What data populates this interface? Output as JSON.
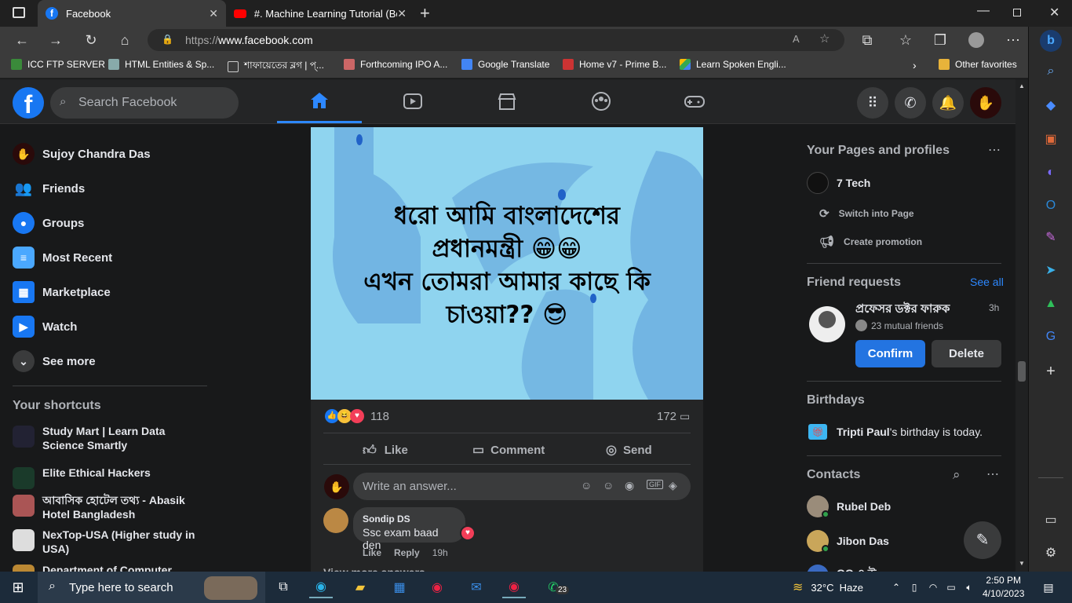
{
  "browser": {
    "tabs": [
      {
        "title": "Facebook",
        "active": true
      },
      {
        "title": "#. Machine Learning Tutorial (Ber",
        "active": false
      }
    ],
    "url_proto": "https://",
    "url_host": "www.facebook.com",
    "bookmarks": [
      "ICC FTP SERVER",
      "HTML Entities & Sp...",
      "শাফায়েতের ব্লগ | প্...",
      "Forthcoming IPO A...",
      "Google Translate",
      "Home v7 - Prime B...",
      "Learn Spoken Engli..."
    ],
    "other_favorites": "Other favorites"
  },
  "fb": {
    "search_placeholder": "Search Facebook",
    "left": {
      "profile": "Sujoy Chandra Das",
      "items": [
        "Friends",
        "Groups",
        "Most Recent",
        "Marketplace",
        "Watch"
      ],
      "see_more": "See more",
      "shortcuts_title": "Your shortcuts",
      "shortcuts": [
        "Study Mart | Learn Data Science Smartly",
        "Elite Ethical Hackers",
        "আবাসিক হোটেল তথ্য - Abasik Hotel Bangladesh",
        "NexTop-USA (Higher study in USA)",
        "Department of Computer"
      ]
    },
    "post": {
      "text_line1": "ধরো আমি বাংলাদেশের",
      "text_line2": "প্রধানমন্ত্রী 😁😁",
      "text_line3": "এখন তোমরা আমার কাছে কি",
      "text_line4": "চাওয়া?? 😎",
      "reactions_count": "118",
      "comments_count": "172",
      "like": "Like",
      "comment": "Comment",
      "send": "Send",
      "write_placeholder": "Write an answer...",
      "comment_author": "Sondip DS",
      "comment_text": "Ssc exam baad den",
      "comment_like": "Like",
      "comment_reply": "Reply",
      "comment_time": "19h",
      "view_more": "View more answers"
    },
    "right": {
      "pages_title": "Your Pages and profiles",
      "page_name": "7 Tech",
      "switch_page": "Switch into Page",
      "create_promo": "Create promotion",
      "fr_title": "Friend requests",
      "see_all": "See all",
      "fr_name": "প্রফেসর ডক্টর ফারুক",
      "fr_time": "3h",
      "fr_mutual": "23 mutual friends",
      "confirm": "Confirm",
      "delete": "Delete",
      "birthdays_title": "Birthdays",
      "birthday_name": "Tripti Paul",
      "birthday_rest": "'s birthday is today.",
      "contacts_title": "Contacts",
      "contacts": [
        "Rubel Deb",
        "Jibon Das",
        "GG ও উ"
      ]
    }
  },
  "taskbar": {
    "search_placeholder": "Type here to search",
    "weather": "32°C  Haze",
    "time": "2:50 PM",
    "date": "4/10/2023",
    "whatsapp_badge": "23"
  },
  "colors": {
    "fb_blue": "#1877f2",
    "bg": "#18191a",
    "card": "#242526"
  }
}
